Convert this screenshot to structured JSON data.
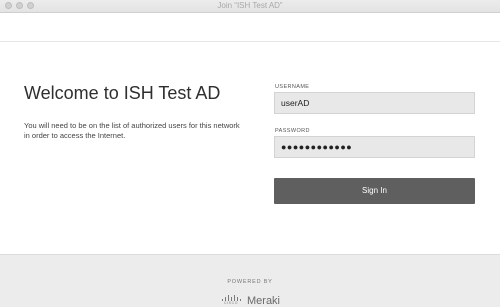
{
  "window": {
    "title": "Join “ISH Test AD”"
  },
  "main": {
    "heading": "Welcome to ISH Test AD",
    "description": "You will need to be on the list of authorized users for this network in order to access the Internet."
  },
  "form": {
    "username_label": "USERNAME",
    "username_value": "userAD",
    "password_label": "PASSWORD",
    "password_value": "●●●●●●●●●●●●",
    "submit_label": "Sign In"
  },
  "footer": {
    "powered_by": "POWERED BY",
    "logo_small": "CISCO",
    "logo_brand": "Meraki"
  },
  "colors": {
    "button": "#5f5f5f",
    "field_bg": "#e8e8e8",
    "footer_bg": "#ececec"
  }
}
